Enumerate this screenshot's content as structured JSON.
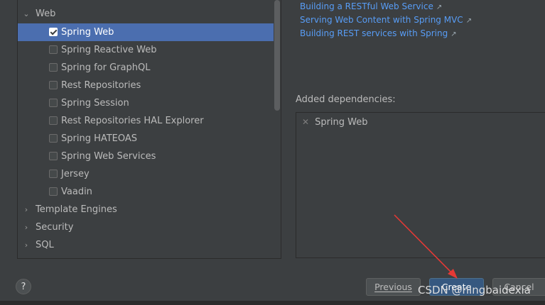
{
  "tree": {
    "web_group": {
      "label": "Web",
      "expanded": true
    },
    "items": [
      {
        "label": "Spring Web",
        "checked": true,
        "selected": true
      },
      {
        "label": "Spring Reactive Web",
        "checked": false
      },
      {
        "label": "Spring for GraphQL",
        "checked": false
      },
      {
        "label": "Rest Repositories",
        "checked": false
      },
      {
        "label": "Spring Session",
        "checked": false
      },
      {
        "label": "Rest Repositories HAL Explorer",
        "checked": false
      },
      {
        "label": "Spring HATEOAS",
        "checked": false
      },
      {
        "label": "Spring Web Services",
        "checked": false
      },
      {
        "label": "Jersey",
        "checked": false
      },
      {
        "label": "Vaadin",
        "checked": false
      }
    ],
    "collapsed_groups": [
      {
        "label": "Template Engines"
      },
      {
        "label": "Security"
      },
      {
        "label": "SQL"
      }
    ]
  },
  "guides": [
    {
      "label": "Building a RESTful Web Service",
      "icon": "external-link-arrow"
    },
    {
      "label": "Serving Web Content with Spring MVC",
      "icon": "external-link-arrow"
    },
    {
      "label": "Building REST services with Spring",
      "icon": "external-link-arrow"
    }
  ],
  "added_dependencies": {
    "label": "Added dependencies:",
    "items": [
      {
        "label": "Spring Web",
        "remove_icon": "close-icon"
      }
    ]
  },
  "buttons": {
    "help": "?",
    "previous": "Previous",
    "create": "Create",
    "cancel": "Cancel"
  },
  "watermark": "CSDN @ningbaidexia",
  "colors": {
    "background": "#3c3f41",
    "selection": "#4b6eaf",
    "link": "#589df6",
    "annotation_arrow": "#e53935"
  }
}
